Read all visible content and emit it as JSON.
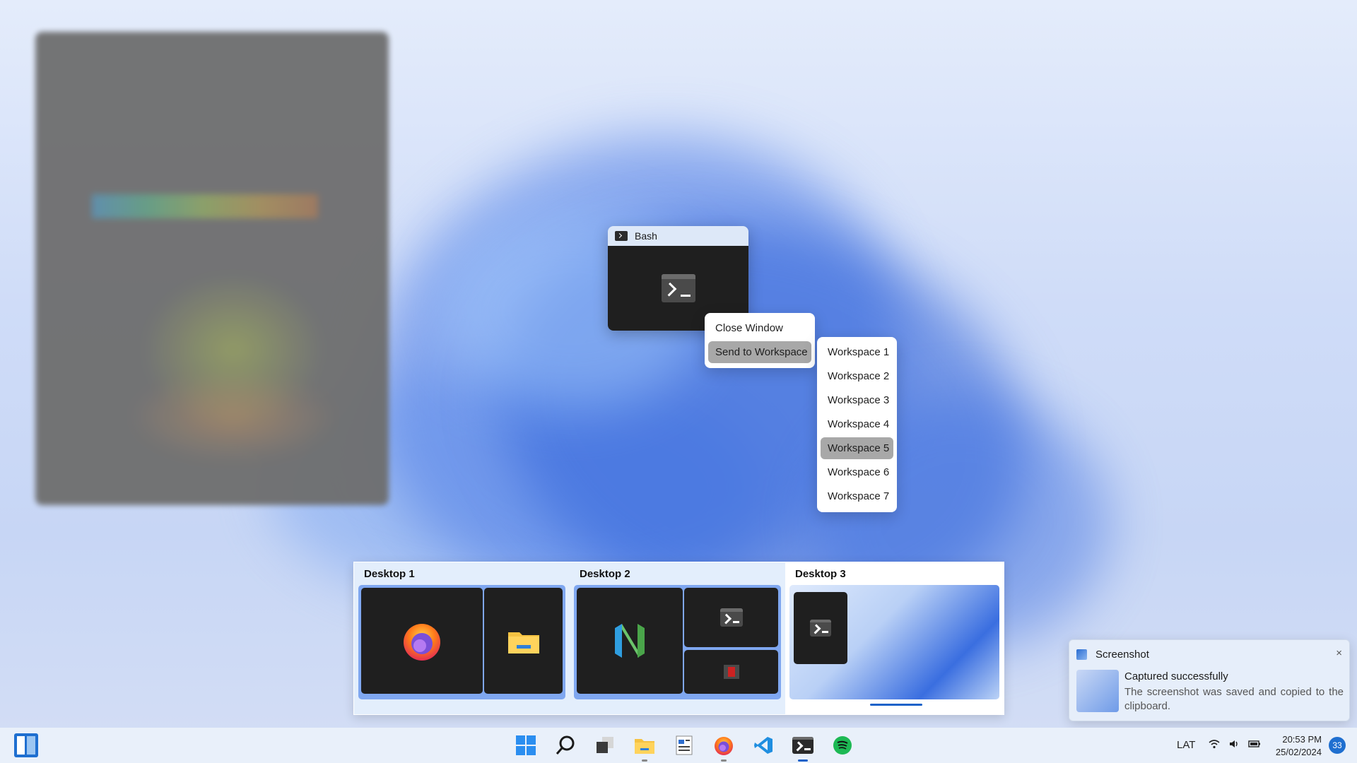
{
  "window_preview": {
    "title": "Bash"
  },
  "context_menu": {
    "items": [
      {
        "label": "Close Window"
      },
      {
        "label": "Send to Workspace"
      }
    ]
  },
  "workspace_menu": {
    "items": [
      {
        "label": "Workspace 1"
      },
      {
        "label": "Workspace 2"
      },
      {
        "label": "Workspace 3"
      },
      {
        "label": "Workspace 4"
      },
      {
        "label": "Workspace 5"
      },
      {
        "label": "Workspace 6"
      },
      {
        "label": "Workspace 7"
      }
    ],
    "highlighted": "Workspace 5"
  },
  "task_view": {
    "desktops": [
      {
        "label": "Desktop 1",
        "apps": [
          "firefox-icon",
          "file-explorer-icon"
        ]
      },
      {
        "label": "Desktop 2",
        "apps": [
          "neovim-icon",
          "terminal-icon",
          "app-icon"
        ]
      },
      {
        "label": "Desktop 3",
        "apps": [
          "terminal-icon"
        ]
      }
    ],
    "active_desktop": "Desktop 3"
  },
  "notification": {
    "app": "Screenshot",
    "close": "×",
    "title": "Captured successfully",
    "body": "The screenshot was saved and copied to the clipboard."
  },
  "taskbar": {
    "apps": [
      "start-icon",
      "search-icon",
      "task-view-icon",
      "file-explorer-icon",
      "notepad-icon",
      "firefox-icon",
      "vscode-icon",
      "terminal-icon",
      "spotify-icon"
    ],
    "language": "LAT",
    "time": "20:53 PM",
    "date": "25/02/2024",
    "notification_count": "33"
  }
}
